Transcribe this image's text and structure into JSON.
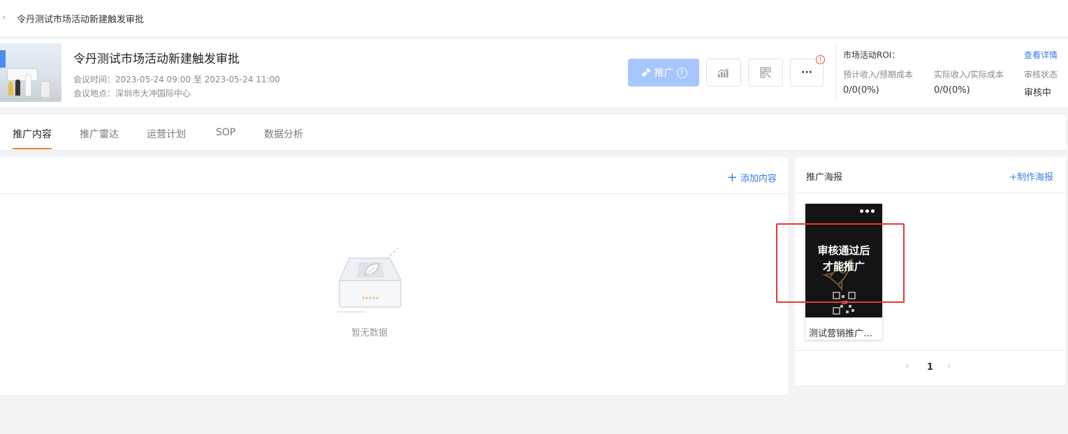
{
  "breadcrumb": {
    "chevron": "›",
    "current": "令丹测试市场活动新建触发审批"
  },
  "event": {
    "title": "令丹测试市场活动新建触发审批",
    "time_label": "会议时间：2023-05-24 09:00 至 2023-05-24 11:00",
    "place_label": "会议地点：深圳市大冲国际中心"
  },
  "actions": {
    "promote_label": "推广",
    "help_glyph": "?",
    "more_glyph": "···",
    "alert_glyph": "!"
  },
  "roi": {
    "title": "市场活动ROI：",
    "detail_link": "查看详情",
    "columns": [
      {
        "label": "预计收入/预期成本",
        "value": "0/0(0%)"
      },
      {
        "label": "实际收入/实际成本",
        "value": "0/0(0%)"
      },
      {
        "label": "审核状态",
        "value": "审核中"
      }
    ]
  },
  "tabs": [
    {
      "label": "推广内容",
      "active": true
    },
    {
      "label": "推广雷达",
      "active": false
    },
    {
      "label": "运营计划",
      "active": false
    },
    {
      "label": "SOP",
      "active": false
    },
    {
      "label": "数据分析",
      "active": false
    }
  ],
  "content": {
    "add_label": "添加内容",
    "add_glyph": "+",
    "empty_text": "暂无数据"
  },
  "posters": {
    "title": "推广海报",
    "make_label": "+制作海报",
    "items": [
      {
        "overlay_line1": "审核通过后",
        "overlay_line2": "才能推广",
        "name": "测试营销推广…",
        "menu_glyph": "•••"
      }
    ],
    "pager": {
      "prev": "‹",
      "current": "1",
      "next": "›"
    }
  },
  "colors": {
    "accent_blue": "#3a7ce8",
    "promote_disabled": "#a7c6fb",
    "tab_active_underline": "#e8852e",
    "highlight_red": "#e53935"
  }
}
